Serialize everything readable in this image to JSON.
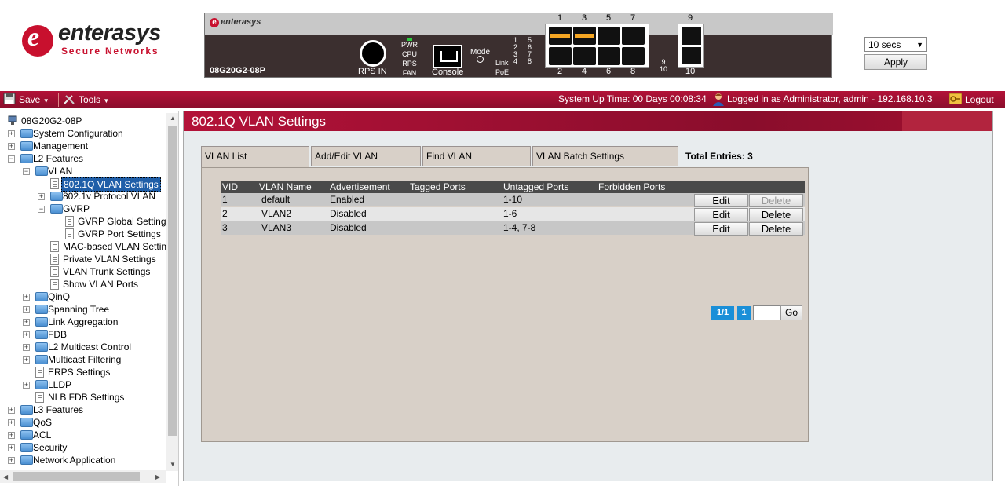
{
  "header": {
    "logo_word": "enterasys",
    "logo_tagline": "Secure Networks",
    "device_brand": "enterasys",
    "device_model": "08G20G2-08P",
    "device_labels": {
      "rps_in": "RPS IN",
      "pwr": "PWR",
      "cpu": "CPU",
      "rps": "RPS",
      "fan": "FAN",
      "console": "Console",
      "mode": "Mode",
      "link": "Link",
      "poe": "PoE"
    },
    "led_numbers": [
      "1",
      "2",
      "3",
      "4",
      "5",
      "6",
      "7",
      "8",
      "9",
      "10"
    ],
    "top_port_numbers": [
      "1",
      "3",
      "5",
      "7"
    ],
    "bottom_port_numbers": [
      "2",
      "4",
      "6",
      "8"
    ],
    "sfp_top": "9",
    "sfp_bottom": "10",
    "refresh_select": "10 secs",
    "apply_label": "Apply"
  },
  "toolbar": {
    "save_label": "Save",
    "tools_label": "Tools",
    "uptime": "System Up Time: 00 Days 00:08:34",
    "logged_in": "Logged in as Administrator, admin - 192.168.10.3",
    "logout_label": "Logout"
  },
  "tree": {
    "root": "08G20G2-08P",
    "items": [
      "System Configuration",
      "Management",
      "L2 Features",
      "VLAN",
      "802.1Q VLAN Settings",
      "802.1v Protocol VLAN",
      "GVRP",
      "GVRP Global Settings",
      "GVRP Port Settings",
      "MAC-based VLAN Settings",
      "Private VLAN Settings",
      "VLAN Trunk Settings",
      "Show VLAN Ports",
      "QinQ",
      "Spanning Tree",
      "Link Aggregation",
      "FDB",
      "L2 Multicast Control",
      "Multicast Filtering",
      "ERPS Settings",
      "LLDP",
      "NLB FDB Settings",
      "L3 Features",
      "QoS",
      "ACL",
      "Security",
      "Network Application"
    ]
  },
  "main": {
    "title": "802.1Q VLAN Settings",
    "tabs": [
      "VLAN List",
      "Add/Edit VLAN",
      "Find VLAN",
      "VLAN Batch Settings"
    ],
    "total_entries": "Total Entries: 3",
    "columns": [
      "VID",
      "VLAN Name",
      "Advertisement",
      "Tagged Ports",
      "Untagged Ports",
      "Forbidden Ports"
    ],
    "rows": [
      {
        "vid": "1",
        "name": "default",
        "adv": "Enabled",
        "tagged": "",
        "untagged": "1-10",
        "forbidden": ""
      },
      {
        "vid": "2",
        "name": "VLAN2",
        "adv": "Disabled",
        "tagged": "",
        "untagged": "1-6",
        "forbidden": ""
      },
      {
        "vid": "3",
        "name": "VLAN3",
        "adv": "Disabled",
        "tagged": "",
        "untagged": "1-4, 7-8",
        "forbidden": ""
      }
    ],
    "edit_label": "Edit",
    "delete_label": "Delete",
    "pager_total": "1/1",
    "pager_current": "1",
    "go_label": "Go"
  },
  "colors": {
    "brand_red": "#c8102e",
    "toolbar_bg": "#a0102f",
    "selected_bg": "#1f5ea8",
    "pager_blue": "#1a8fd8",
    "port_active": "#f5a623"
  }
}
